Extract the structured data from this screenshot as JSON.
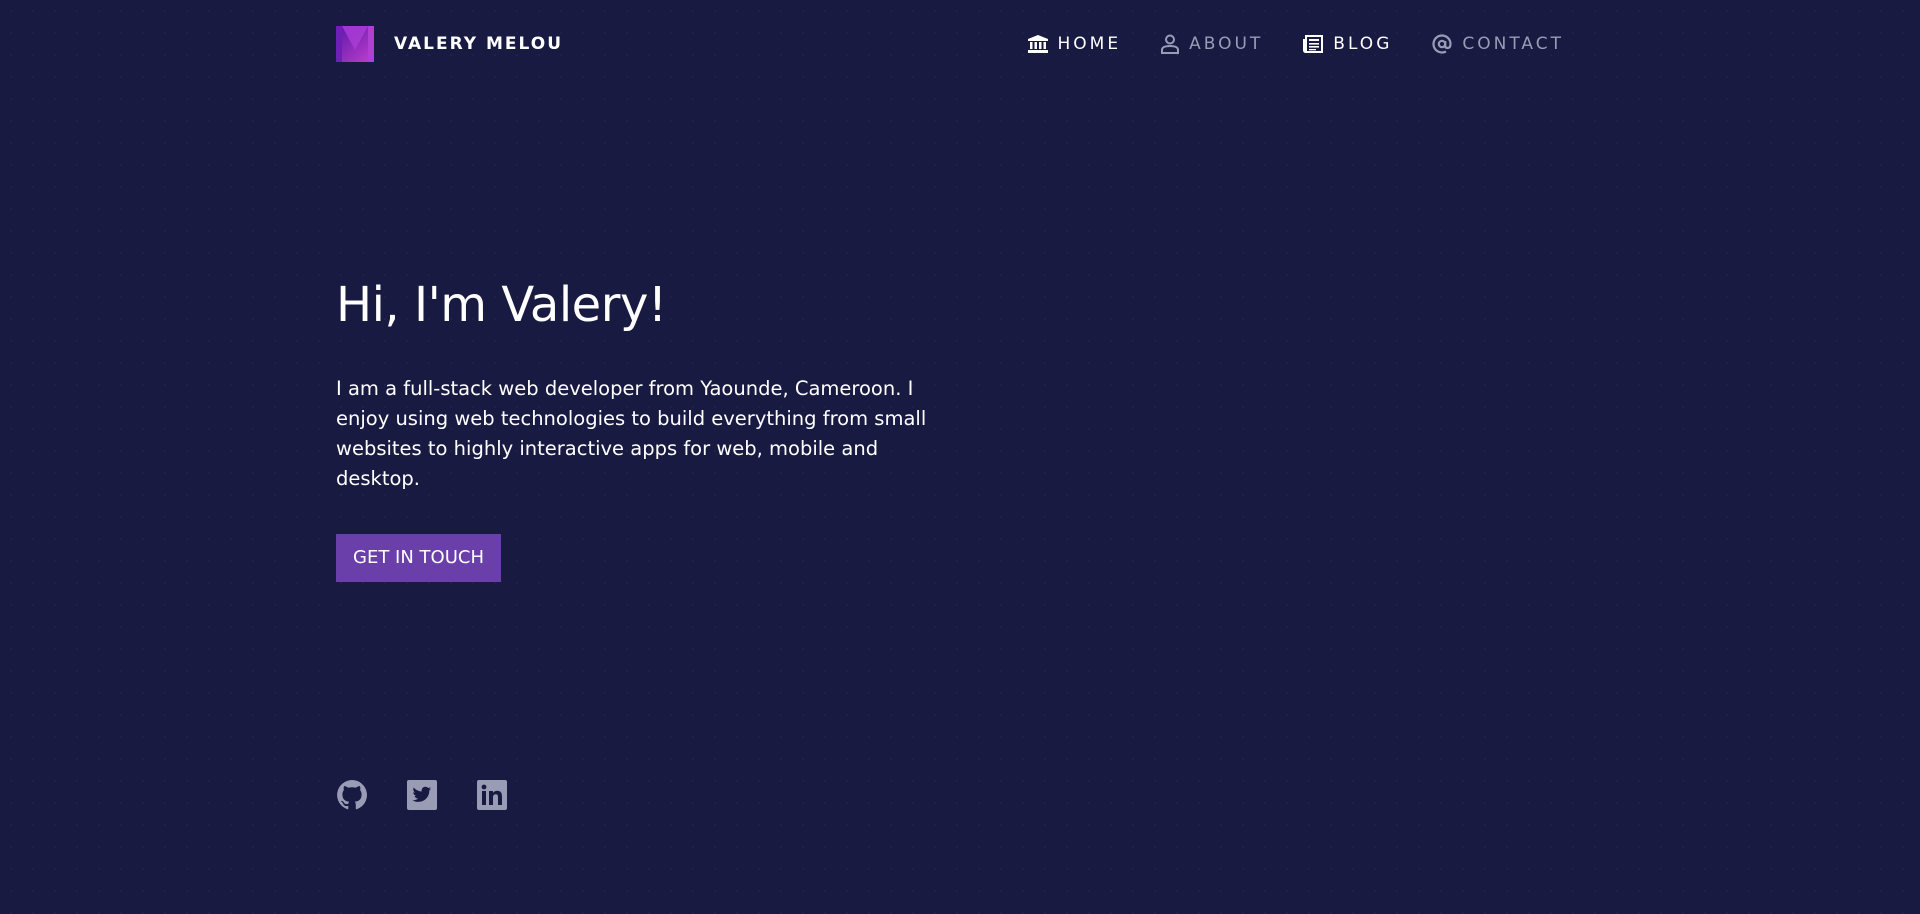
{
  "brand": {
    "name": "VALERY MELOU",
    "logo_icon": "m-logo-icon",
    "logo_colors": [
      "#6a1fb3",
      "#c03fd0"
    ]
  },
  "nav": {
    "items": [
      {
        "label": "HOME",
        "icon": "bank-icon",
        "active": true
      },
      {
        "label": "ABOUT",
        "icon": "person-icon",
        "active": false
      },
      {
        "label": "BLOG",
        "icon": "newspaper-icon",
        "active": true
      },
      {
        "label": "CONTACT",
        "icon": "at-icon",
        "active": false
      }
    ]
  },
  "hero": {
    "title": "Hi, I'm Valery!",
    "description": "I am a full-stack web developer from Yaounde, Cameroon. I enjoy using web technologies to build everything from small websites to highly interactive apps for web, mobile and desktop.",
    "cta_label": "GET IN TOUCH"
  },
  "social": [
    {
      "icon": "github-icon"
    },
    {
      "icon": "twitter-icon"
    },
    {
      "icon": "linkedin-icon"
    }
  ],
  "colors": {
    "background": "#181a42",
    "accent": "#6a3fa9",
    "muted": "#9a9bb4",
    "text": "#ffffff"
  }
}
